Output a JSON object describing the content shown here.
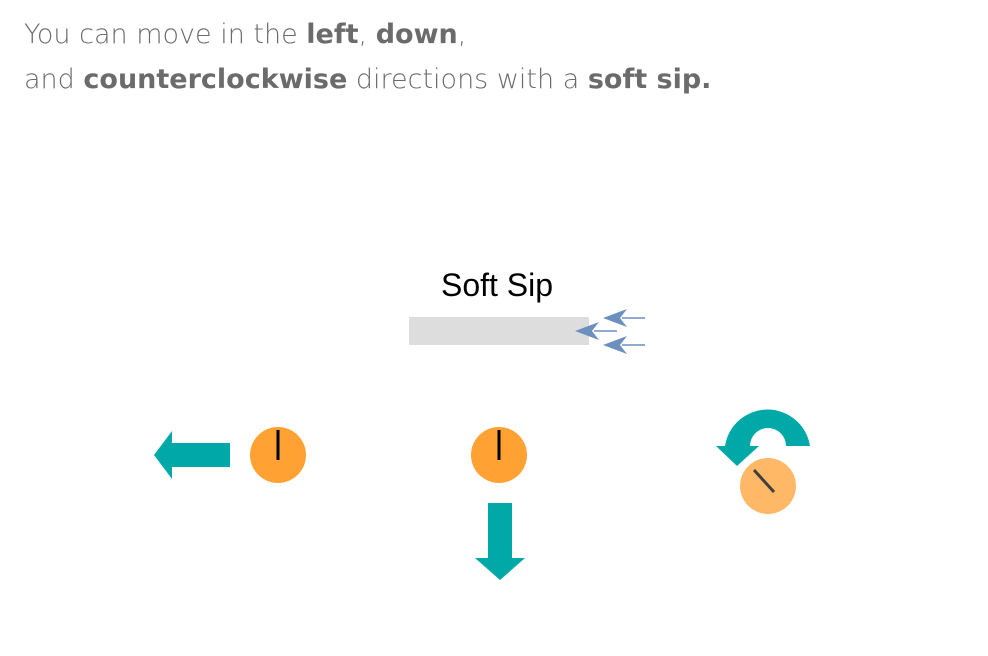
{
  "instruction": {
    "line1_pre": "You can move in the ",
    "line1_b1": "left",
    "line1_mid": ", ",
    "line1_b2": "down",
    "line1_end": ",",
    "line2_pre": "and ",
    "line2_b1": "counterclockwise",
    "line2_mid": " directions with a ",
    "line2_b2": "soft sip."
  },
  "sip": {
    "label": "Soft Sip"
  },
  "colors": {
    "text": "#6b6b6b",
    "arrow_teal": "#00a8a8",
    "knob_orange": "#ffa233",
    "knob_orange_light": "#ffbe6a",
    "straw_gray": "#dddddd",
    "airflow_blue": "#6b8fbf",
    "indicator": "#000000"
  },
  "icons": {
    "left_arrow": "arrow-left-icon",
    "down_arrow": "arrow-down-icon",
    "ccw_arrow": "counterclockwise-arrow-icon",
    "knob": "knob-icon",
    "straw": "straw-icon",
    "airflow": "airflow-arrows-icon"
  }
}
